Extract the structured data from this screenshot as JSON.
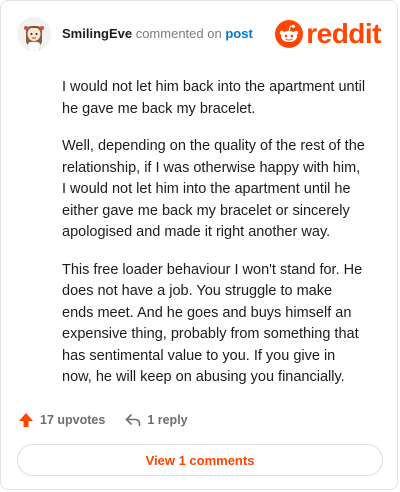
{
  "header": {
    "username": "SmilingEve",
    "verb": "commented on",
    "post_link": "post",
    "logo_text": "reddit",
    "logo_icon": "snoo-icon",
    "brand_color": "#ff4500"
  },
  "comment": {
    "paragraphs": [
      "I would not let him back into the apartment until he gave me back my bracelet.",
      "Well, depending on the quality of the rest of the relationship, if I was otherwise happy with him, I would not let him into the apartment until he either gave me back my bracelet or sincerely apologised and made it right another way.",
      "This free loader behaviour I won't stand for. He does not have a job. You struggle to make ends meet. And he goes and buys himself an expensive thing, probably from something that has sentimental value to you. If you give in now, he will keep on abusing you financially."
    ]
  },
  "actions": {
    "upvotes_label": "17 upvotes",
    "upvote_icon": "upvote-arrow-icon",
    "reply_label": "1 reply",
    "reply_icon": "reply-arrow-icon"
  },
  "view_button": {
    "label": "View 1 comments"
  }
}
